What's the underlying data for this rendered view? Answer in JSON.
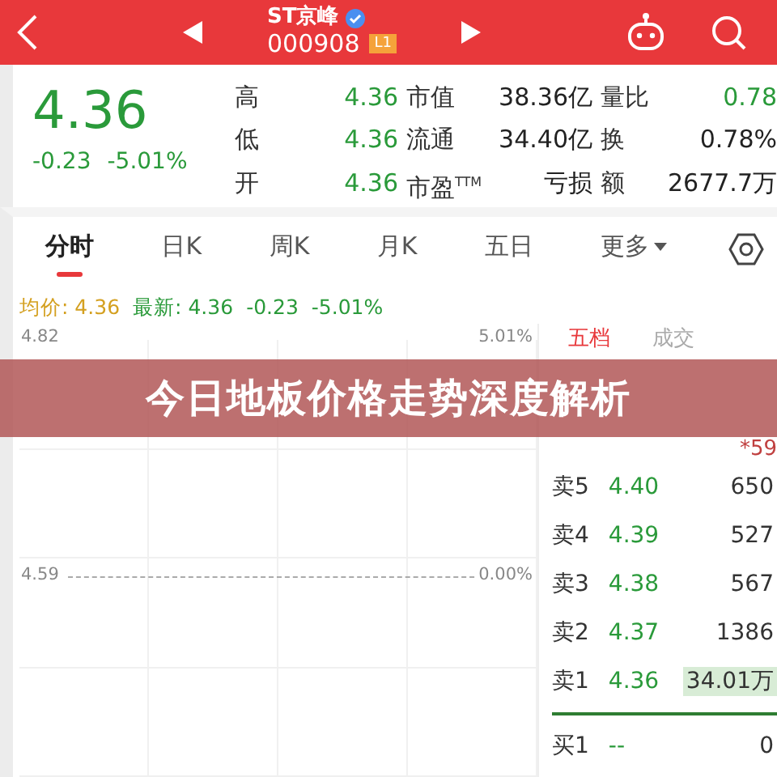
{
  "header": {
    "title": "ST京峰",
    "code": "000908",
    "badge": "L1"
  },
  "quote": {
    "price": "4.36",
    "change": "-0.23",
    "percent": "-5.01%",
    "stats": [
      {
        "label": "高",
        "value": "4.36",
        "color": "#2a9a3a"
      },
      {
        "label": "市值",
        "value": "38.36亿",
        "color": "#222222"
      },
      {
        "label": "量比",
        "value": "0.78",
        "color": "#2a9a3a"
      },
      {
        "label": "低",
        "value": "4.36",
        "color": "#2a9a3a"
      },
      {
        "label": "流通",
        "value": "34.40亿",
        "color": "#222222"
      },
      {
        "label": "换",
        "value": "0.78%",
        "color": "#222222"
      },
      {
        "label": "开",
        "value": "4.36",
        "color": "#2a9a3a"
      },
      {
        "label": "市盈$^{TTM}$",
        "value": "亏损",
        "color": "#222222"
      },
      {
        "label": "额",
        "value": "2677.7万",
        "color": "#222222"
      }
    ]
  },
  "tabs": [
    {
      "label": "分时",
      "selected": true,
      "kind": "tab"
    },
    {
      "label": "日K",
      "selected": false,
      "kind": "tab"
    },
    {
      "label": "周K",
      "selected": false,
      "kind": "tab"
    },
    {
      "label": "月K",
      "selected": false,
      "kind": "tab"
    },
    {
      "label": "五日",
      "selected": false,
      "kind": "tab"
    },
    {
      "label": "更多",
      "selected": false,
      "kind": "menu"
    }
  ],
  "info": {
    "average": "均价: 4.36",
    "latest": "最新: 4.36",
    "change": "-0.23",
    "percent": "-5.01%"
  },
  "chart": {
    "top_price": "4.82",
    "top_percent": "5.01%",
    "mid_price": "4.59",
    "mid_percent": "0.00%"
  },
  "order_book": {
    "tabs": [
      {
        "label": "五档",
        "selected": true
      },
      {
        "label": "成交",
        "selected": false
      }
    ],
    "partial_volume": "*59",
    "asks": [
      {
        "label": "卖5",
        "price": "4.40",
        "volume": "650",
        "highlighted": false
      },
      {
        "label": "卖4",
        "price": "4.39",
        "volume": "527",
        "highlighted": false
      },
      {
        "label": "卖3",
        "price": "4.38",
        "volume": "567",
        "highlighted": false
      },
      {
        "label": "卖2",
        "price": "4.37",
        "volume": "1386",
        "highlighted": false
      },
      {
        "label": "卖1",
        "price": "4.36",
        "volume": "34.01万",
        "highlighted": true
      }
    ],
    "bids": [
      {
        "label": "买1",
        "price": "--",
        "volume": "0",
        "highlighted": false
      }
    ]
  },
  "banner": {
    "title": "今日地板价格走势深度解析"
  }
}
